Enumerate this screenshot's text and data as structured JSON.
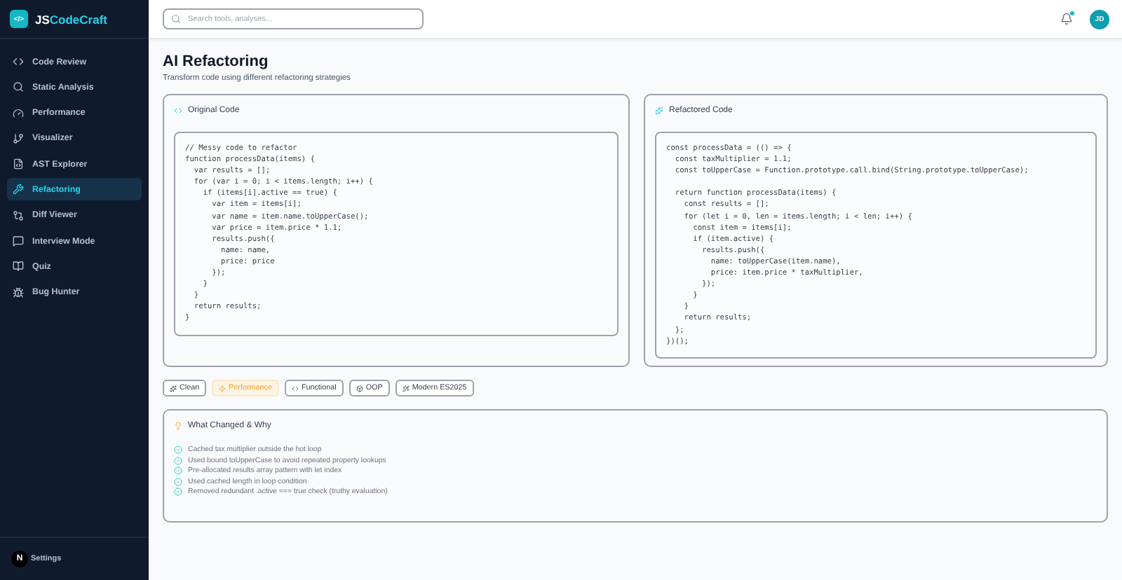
{
  "brand": {
    "logo": "</>",
    "prefix": "JS",
    "name": "CodeCraft"
  },
  "sidebar": {
    "items": [
      {
        "label": "Code Review",
        "selected": false
      },
      {
        "label": "Static Analysis",
        "selected": false
      },
      {
        "label": "Performance",
        "selected": false
      },
      {
        "label": "Visualizer",
        "selected": false
      },
      {
        "label": "AST Explorer",
        "selected": false
      },
      {
        "label": "Refactoring",
        "selected": true
      },
      {
        "label": "Diff Viewer",
        "selected": false
      },
      {
        "label": "Interview Mode",
        "selected": false
      },
      {
        "label": "Quiz",
        "selected": false
      },
      {
        "label": "Bug Hunter",
        "selected": false
      }
    ],
    "footer": {
      "avatar": "N",
      "label": "Settings"
    }
  },
  "header": {
    "search": {
      "placeholder": "Search tools, analyses..."
    },
    "notification_dot": true,
    "avatar": "JD"
  },
  "page": {
    "title": "AI Refactoring",
    "subtitle": "Transform code using different refactoring strategies"
  },
  "panels": [
    {
      "title": "Original Code",
      "code": [
        [
          "// Messy code to refactor",
          "function processData(items) {",
          "  var results = [];",
          "  for (var i = 0; i < items.length; i++) {",
          "    if (items[i].active == true) {",
          "      var item = items[i];",
          "      var name = item.name.toUpperCase();",
          "      var price = item.price * 1.1;",
          "      results.push({",
          "        name: name,",
          "        price: price",
          "      });",
          "    }",
          "  }",
          "  return results;",
          "}"
        ]
      ]
    },
    {
      "title": "Refactored Code",
      "code": [
        [
          "const processData = (() => {",
          "  const taxMultiplier = 1.1;",
          "  const toUpperCase = Function.prototype.call.bind(String.prototype.toUpperCase);"
        ],
        [
          "  return function processData(items) {",
          "    const results = [];",
          "    for (let i = 0, len = items.length; i < len; i++) {",
          "      const item = items[i];",
          "      if (item.active) {",
          "        results.push({",
          "          name: toUpperCase(item.name),",
          "          price: item.price * taxMultiplier,",
          "        });",
          "      }",
          "    }",
          "    return results;",
          "  };",
          "})();"
        ]
      ]
    }
  ],
  "strategies": [
    {
      "label": "Clean",
      "selected": false
    },
    {
      "label": "Performance",
      "selected": true
    },
    {
      "label": "Functional",
      "selected": false
    },
    {
      "label": "OOP",
      "selected": false
    },
    {
      "label": "Modern ES2025",
      "selected": false
    }
  ],
  "changes": {
    "title": "What Changed & Why",
    "items": [
      "Cached tax multiplier outside the hot loop",
      "Used bound toUpperCase to avoid repeated property lookups",
      "Pre-allocated results array pattern with let index",
      "Used cached length in loop condition",
      "Removed redundant .active === true check (truthy evaluation)"
    ]
  }
}
